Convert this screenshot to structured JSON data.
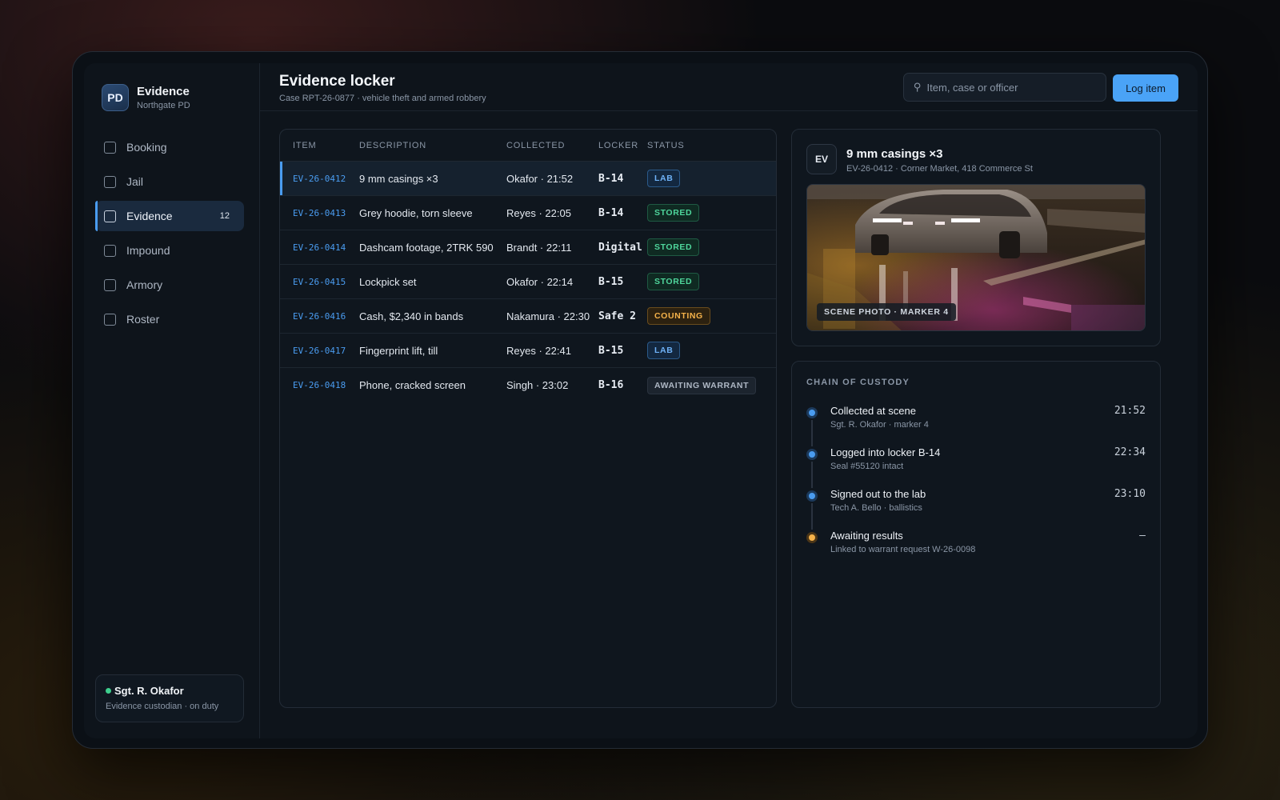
{
  "sidebar": {
    "brand_initials": "PD",
    "brand_title": "Evidence",
    "brand_subtitle": "Northgate PD",
    "items": [
      {
        "label": "Booking",
        "count": ""
      },
      {
        "label": "Jail",
        "count": ""
      },
      {
        "label": "Evidence",
        "count": "12",
        "active": true
      },
      {
        "label": "Impound",
        "count": ""
      },
      {
        "label": "Armory",
        "count": ""
      },
      {
        "label": "Roster",
        "count": ""
      }
    ],
    "user": {
      "name": "Sgt. R. Okafor",
      "role": "Evidence custodian · on duty",
      "status_color": "#3ecf8e"
    }
  },
  "header": {
    "title": "Evidence locker",
    "subtitle": "Case RPT-26-0877 · vehicle theft and armed robbery",
    "search_placeholder": "Item, case or officer",
    "search_icon": "search-icon",
    "primary_button": "Log item"
  },
  "table": {
    "columns": [
      "ITEM",
      "DESCRIPTION",
      "COLLECTED",
      "LOCKER",
      "STATUS"
    ],
    "rows": [
      {
        "item": "EV-26-0412",
        "description": "9 mm casings ×3",
        "collected": "Okafor · 21:52",
        "locker": "B-14",
        "status": "LAB",
        "status_kind": "lab",
        "selected": true
      },
      {
        "item": "EV-26-0413",
        "description": "Grey hoodie, torn sleeve",
        "collected": "Reyes · 22:05",
        "locker": "B-14",
        "status": "STORED",
        "status_kind": "stored"
      },
      {
        "item": "EV-26-0414",
        "description": "Dashcam footage, 2TRK 590",
        "collected": "Brandt · 22:11",
        "locker": "Digital",
        "status": "STORED",
        "status_kind": "stored"
      },
      {
        "item": "EV-26-0415",
        "description": "Lockpick set",
        "collected": "Okafor · 22:14",
        "locker": "B-15",
        "status": "STORED",
        "status_kind": "stored"
      },
      {
        "item": "EV-26-0416",
        "description": "Cash, $2,340 in bands",
        "collected": "Nakamura · 22:30",
        "locker": "Safe 2",
        "status": "COUNTING",
        "status_kind": "counting"
      },
      {
        "item": "EV-26-0417",
        "description": "Fingerprint lift, till",
        "collected": "Reyes · 22:41",
        "locker": "B-15",
        "status": "LAB",
        "status_kind": "lab"
      },
      {
        "item": "EV-26-0418",
        "description": "Phone, cracked screen",
        "collected": "Singh · 23:02",
        "locker": "B-16",
        "status": "AWAITING WARRANT",
        "status_kind": "warrant"
      }
    ]
  },
  "detail": {
    "badge": "EV",
    "title": "9 mm casings ×3",
    "subtitle": "EV-26-0412 · Corner Market, 418 Commerce St",
    "photo_caption": "SCENE PHOTO · MARKER 4"
  },
  "custody": {
    "heading": "CHAIN OF CUSTODY",
    "events": [
      {
        "title": "Collected at scene",
        "sub": "Sgt. R. Okafor · marker 4",
        "time": "21:52",
        "color": "blue"
      },
      {
        "title": "Logged into locker B-14",
        "sub": "Seal #55120 intact",
        "time": "22:34",
        "color": "blue"
      },
      {
        "title": "Signed out to the lab",
        "sub": "Tech A. Bello · ballistics",
        "time": "23:10",
        "color": "blue"
      },
      {
        "title": "Awaiting results",
        "sub": "Linked to warrant request W-26-0098",
        "time": "–",
        "color": "amber"
      }
    ]
  },
  "colors": {
    "accent": "#4a9cf0",
    "primary_button": "#4aa3f7",
    "stored": "#4fd69c",
    "counting": "#f5b24a"
  }
}
